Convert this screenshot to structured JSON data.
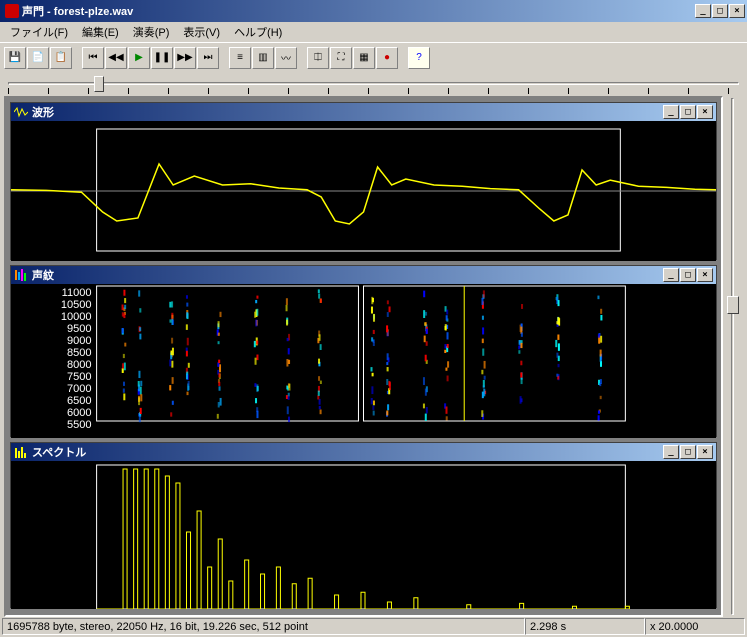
{
  "title": "声門  - forest-plze.wav",
  "menu": {
    "file": "ファイル(F)",
    "edit": "編集(E)",
    "play": "演奏(P)",
    "view": "表示(V)",
    "help": "ヘルプ(H)"
  },
  "toolbar": {
    "save": "💾",
    "copy": "📄",
    "paste": "📋",
    "rewind_all": "⏮",
    "rewind": "◀◀",
    "play": "▶",
    "pause": "❚❚",
    "ff": "▶▶",
    "ff_all": "⏭",
    "fx1": "≡",
    "fx2": "▥",
    "fx3": "〰",
    "split": "⎅",
    "full": "⛶",
    "grid": "▦",
    "rec": "●",
    "help": "?"
  },
  "slider": {
    "pos_pct": 12
  },
  "panes": {
    "waveform": {
      "title": "波形"
    },
    "spectrogram": {
      "title": "声紋",
      "yticks": [
        "11000",
        "10500",
        "10000",
        "9500",
        "9000",
        "8500",
        "8000",
        "7500",
        "7000",
        "6500",
        "6000",
        "5500"
      ]
    },
    "spectrum": {
      "title": "スペクトル"
    }
  },
  "vslider": {
    "pos_pct": 40
  },
  "status": {
    "info": "1695788 byte, stereo, 22050 Hz, 16 bit, 19.226 sec, 512 point",
    "time": "2.298 s",
    "zoom": "x 20.0000"
  },
  "chart_data": [
    {
      "type": "line",
      "name": "waveform",
      "xrange": [
        0,
        1
      ],
      "yrange": [
        -1,
        1
      ],
      "points": [
        [
          0,
          0.02
        ],
        [
          0.05,
          0.01
        ],
        [
          0.1,
          -0.02
        ],
        [
          0.13,
          -0.35
        ],
        [
          0.15,
          -0.5
        ],
        [
          0.18,
          -0.45
        ],
        [
          0.21,
          0.45
        ],
        [
          0.23,
          0.1
        ],
        [
          0.26,
          0.25
        ],
        [
          0.3,
          0.1
        ],
        [
          0.34,
          0.12
        ],
        [
          0.38,
          0.05
        ],
        [
          0.42,
          0.02
        ],
        [
          0.44,
          -0.1
        ],
        [
          0.46,
          -0.5
        ],
        [
          0.48,
          -0.55
        ],
        [
          0.5,
          -0.35
        ],
        [
          0.52,
          0.4
        ],
        [
          0.54,
          0.1
        ],
        [
          0.56,
          0.2
        ],
        [
          0.6,
          0.1
        ],
        [
          0.64,
          0.08
        ],
        [
          0.68,
          0.04
        ],
        [
          0.72,
          0.02
        ],
        [
          0.75,
          -0.3
        ],
        [
          0.77,
          -0.5
        ],
        [
          0.79,
          -0.4
        ],
        [
          0.81,
          0.35
        ],
        [
          0.83,
          0.1
        ],
        [
          0.85,
          0.18
        ],
        [
          0.89,
          0.08
        ],
        [
          0.93,
          0.06
        ],
        [
          0.97,
          0.03
        ],
        [
          1,
          0.02
        ]
      ]
    },
    {
      "type": "heatmap",
      "name": "spectrogram",
      "xrange": [
        0,
        19.226
      ],
      "yrange": [
        5500,
        11000
      ],
      "bands_x": [
        0.05,
        0.08,
        0.14,
        0.17,
        0.23,
        0.3,
        0.36,
        0.42,
        0.52,
        0.55,
        0.62,
        0.66,
        0.73,
        0.8,
        0.87,
        0.95
      ]
    },
    {
      "type": "line",
      "name": "spectrum",
      "xrange": [
        0,
        11000
      ],
      "yrange": [
        0,
        1
      ],
      "bars": [
        [
          0.05,
          1.0
        ],
        [
          0.07,
          1.0
        ],
        [
          0.09,
          1.0
        ],
        [
          0.11,
          1.0
        ],
        [
          0.13,
          0.95
        ],
        [
          0.15,
          0.9
        ],
        [
          0.17,
          0.55
        ],
        [
          0.19,
          0.7
        ],
        [
          0.21,
          0.3
        ],
        [
          0.23,
          0.5
        ],
        [
          0.25,
          0.2
        ],
        [
          0.28,
          0.35
        ],
        [
          0.31,
          0.25
        ],
        [
          0.34,
          0.3
        ],
        [
          0.37,
          0.18
        ],
        [
          0.4,
          0.22
        ],
        [
          0.45,
          0.1
        ],
        [
          0.5,
          0.12
        ],
        [
          0.55,
          0.05
        ],
        [
          0.6,
          0.08
        ],
        [
          0.7,
          0.03
        ],
        [
          0.8,
          0.04
        ],
        [
          0.9,
          0.02
        ],
        [
          1.0,
          0.02
        ]
      ]
    }
  ]
}
